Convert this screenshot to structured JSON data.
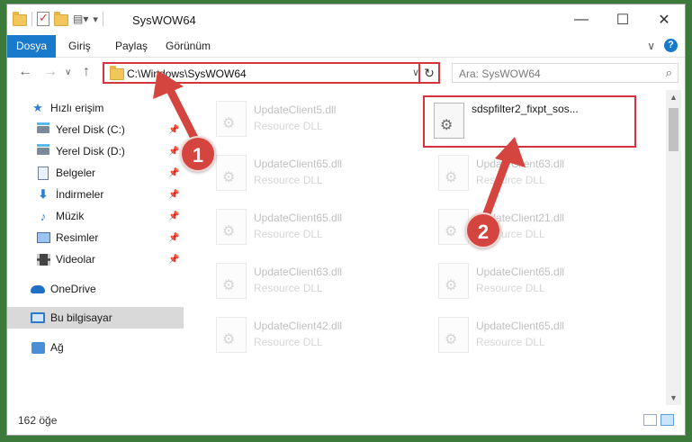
{
  "window": {
    "title": "SysWOW64",
    "controls": {
      "minimize": "—",
      "maximize": "☐",
      "close": "✕"
    }
  },
  "ribbon": {
    "tabs": [
      "Dosya",
      "Giriş",
      "Paylaş",
      "Görünüm"
    ],
    "help": "?"
  },
  "address": {
    "path": "C:\\Windows\\SysWOW64",
    "search_placeholder": "Ara: SysWOW64"
  },
  "nav": {
    "quick_access": "Hızlı erişim",
    "items": [
      {
        "label": "Yerel Disk (C:)",
        "icon": "drive-icon",
        "pinned": true
      },
      {
        "label": "Yerel Disk (D:)",
        "icon": "drive-icon",
        "pinned": true
      },
      {
        "label": "Belgeler",
        "icon": "documents-icon",
        "pinned": true
      },
      {
        "label": "İndirmeler",
        "icon": "downloads-icon",
        "pinned": true
      },
      {
        "label": "Müzik",
        "icon": "music-icon",
        "pinned": true
      },
      {
        "label": "Resimler",
        "icon": "pictures-icon",
        "pinned": true
      },
      {
        "label": "Videolar",
        "icon": "videos-icon",
        "pinned": true
      }
    ],
    "onedrive": "OneDrive",
    "this_pc": "Bu bilgisayar",
    "network": "Ağ"
  },
  "files": {
    "type_label": "Resource DLL",
    "left_column": [
      "UpdateClient5.dll",
      "UpdateClient65.dll",
      "UpdateClient65.dll",
      "UpdateClient63.dll",
      "UpdateClient42.dll"
    ],
    "right_column": [
      "UpdateClient63.dll",
      "UpdateClient21.dll",
      "UpdateClient65.dll",
      "UpdateClient65.dll"
    ],
    "highlighted": "sdspfilter2_fixpt_sos..."
  },
  "status": {
    "count": "162 öğe"
  },
  "callouts": [
    "1",
    "2"
  ],
  "colors": {
    "accent": "#1979ca",
    "highlight": "#d4343e",
    "callout": "#d5453f"
  }
}
